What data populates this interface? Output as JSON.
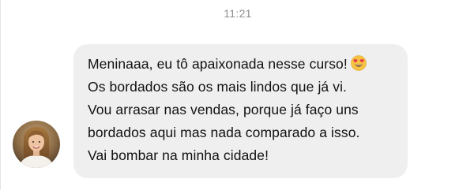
{
  "conversation": {
    "timestamp": "11:21"
  },
  "message": {
    "lines": [
      "Meninaaa, eu tô apaixonada nesse curso!",
      "Os bordados são os mais lindos que já vi.",
      "Vou arrasar nas vendas, porque já faço uns",
      "bordados aqui mas nada comparado a isso.",
      "Vai bombar na minha cidade!"
    ],
    "trailing_emoji": "heart-eyes-emoji"
  },
  "sender": {
    "avatar": "profile-photo-woman"
  },
  "colors": {
    "bubble": "#efefef",
    "text": "#111111",
    "timestamp": "#8e8e93"
  }
}
